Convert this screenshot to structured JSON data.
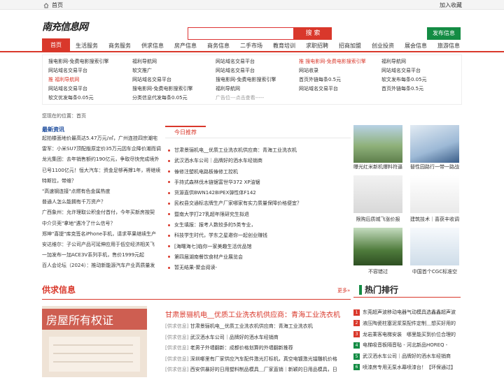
{
  "topbar": {
    "home": "首页",
    "favorite": "加入收藏"
  },
  "header": {
    "logo": "南充信息网",
    "search_placeholder": "",
    "search_label": "搜 索",
    "publish_label": "发布信息"
  },
  "nav": [
    "首页",
    "生活服务",
    "商务服务",
    "供求信息",
    "房产信息",
    "商务信息",
    "二手市场",
    "教育培训",
    "求职招聘",
    "招商加盟",
    "创业投资",
    "展会信息",
    "旅游信息"
  ],
  "links": {
    "col1": [
      "搜电影网-免费电影搜索引擎",
      "网站域名交易平台",
      "推 福利导航网",
      "网站域名交易平台",
      "软文优发每条0.05元"
    ],
    "col2": [
      "福利导航网",
      "软文推广",
      "网站域名交易平台",
      "搜电影网-免费电影搜索引擎",
      "分类信息代发每条0.05元"
    ],
    "col3": [
      "网站域名交易平台",
      "网站域名交易平台",
      "搜电影网-免费电影搜索引擎",
      "福利导航网",
      "广告位---点击查看-----"
    ],
    "col4": [
      "推 搜电影网-免费电影搜索引擎",
      "网站收录",
      "首页外链每条0.5元",
      "网站域名交易平台"
    ],
    "col5": [
      "福利导航网",
      "网站域名交易平台",
      "软文发布每条0.05元",
      "首页外链每条0.5元"
    ]
  },
  "crumb": "您现在的位置：首页",
  "news": {
    "title": "最新资讯",
    "items": [
      "起拍楼面地价最高达5.47万元/㎡，广州连挂四宗潮宅",
      "雷军：小米SU7顶配版原定价35万元因车企降价潮而调",
      "龙光集团：去年销售额约190亿元，争取尽快完成境外",
      "已号1100亿元！恒大汽车：资金足够再撑1年，将继续",
      "特斯拉，带维？",
      "\"高速钢连接\"点燃有色金属热度",
      "普通人怎么能拥有千万资产？",
      "广西象州：允许理取公积金付首付，今年买新房按契",
      "中介贝壳\"拿地\"遇冷了什么信号？",
      "郑坤\"喜提\"库克签名iPhone手机，请求苹果继续生产",
      "安达维尔：子公司产品可延伸应用于低空经济相关飞",
      "一加发布一加ACE3V系列手机，售价1999元起",
      "百人会论坛（2024）：推动新能源汽车产业高质量发"
    ]
  },
  "recommend": {
    "tab": "今日推荐",
    "items": [
      "甘肃景骊机电__优质工业洗衣机供应商：青海工业洗衣机",
      "武汉洒水车公司｜品牌好的洒水车经销商",
      "傣修注塑机电路板傣修工控机",
      "手持式森林伐木链锯富世华372 XP油锯",
      "货源直供BWN142BIPEX弹性体F142",
      "民权县交通标志牌生产厂家哪家有实力质量保障价格便宜？",
      "暨南大学打27乳超年限研究生拟退",
      "女生填报：报考人数较多的5类专业，",
      "科技学生时代，学东之星邀你一起创业赚钱",
      "[海曙海七]临你一家美趣生活优品馆",
      "第四届湖南餐饮食材产业展览会",
      "暂无结果-聚会阅读-"
    ]
  },
  "photos": [
    {
      "caption": "曝光红米新机爆料符逼",
      "color1": "#6a8e5a",
      "color2": "#a9c98a"
    },
    {
      "caption": "替性园路行一带一路战",
      "color1": "#8ea8c9",
      "color2": "#dce6f0"
    },
    {
      "caption": "限购后质城飞涨价报",
      "color1": "#d0d0d0",
      "color2": "#f0f0f0"
    },
    {
      "caption": "建筑技术｜喜获丰收调",
      "color1": "#e8e8e8",
      "color2": "#ffffff"
    },
    {
      "caption": "不容错过",
      "color1": "#2e5c2e",
      "color2": "#9cc27a"
    },
    {
      "caption": "中国首个CGC标准空",
      "color1": "#c9d9e8",
      "color2": "#f4f8fb"
    }
  ],
  "supply": {
    "title": "供求信息",
    "more": "更多»",
    "featured": "甘肃景骊机电__优质工业洗衣机供应商：青海工业洗衣机",
    "items": [
      {
        "tag": "[供求信息]",
        "text": "甘肃景骊机电__优质工业洗衣机供应商：青海工业洗衣机"
      },
      {
        "tag": "[供求信息]",
        "text": "武汉洒水车公司｜品牌好的洒水车经销商"
      },
      {
        "tag": "[供求信息]",
        "text": "老男子外墙翻新：成都价格划算的外墙翻新推荐"
      },
      {
        "tag": "[供求信息]",
        "text": "深圳哪里有厂家供应汽车配件激光打标机，真空电镀激光镭雕机价格"
      },
      {
        "tag": "[供求信息]",
        "text": "西安供暴好的日用塑料制品模具＿厂家直销｜新颖的日用品模具，日"
      }
    ]
  },
  "hot": {
    "title": "热门排行",
    "items": [
      "东莞超声波移动电器气动模具选鑫鑫超声波",
      "液压陶瓷柱塞泥浆泵配件定制＿想买好用的",
      "龙岩乘客电梯安装　哪里能买到价位合理的",
      "电梯吸音板隔音毡 - 河北新品HOREQ -",
      "武汉洒水车公司｜品牌好的洒水车经销商",
      "喷漆房专用无泵水幕喷漆台！【环保通过】"
    ]
  },
  "colors": {
    "accent": "#d9382b",
    "green": "#148c44"
  }
}
